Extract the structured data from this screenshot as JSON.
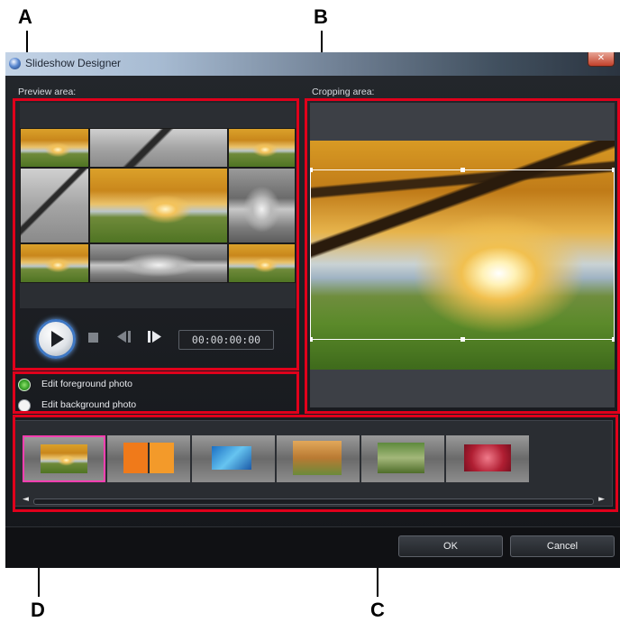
{
  "callouts": {
    "a": "A",
    "b": "B",
    "c": "C",
    "d": "D"
  },
  "window": {
    "title": "Slideshow Designer",
    "close_glyph": "✕"
  },
  "preview": {
    "label": "Preview area:",
    "timecode": "00:00:00:00",
    "icons": [
      "play-icon",
      "stop-icon",
      "previous-frame-icon",
      "next-frame-icon"
    ]
  },
  "cropping": {
    "label": "Cropping area:"
  },
  "photo_edit": {
    "options": [
      {
        "label": "Edit foreground photo",
        "selected": true
      },
      {
        "label": "Edit background photo",
        "selected": false
      }
    ]
  },
  "templates": {
    "count": 6,
    "selected_index": 0,
    "scroll_left": "◄",
    "scroll_right": "►"
  },
  "buttons": {
    "ok": "OK",
    "cancel": "Cancel"
  },
  "colors": {
    "highlight_frame": "#e0001b",
    "selected_thumb": "#ff3fb1",
    "play_ring": "#3f78c4",
    "radio_selected": "#3aa12a"
  }
}
